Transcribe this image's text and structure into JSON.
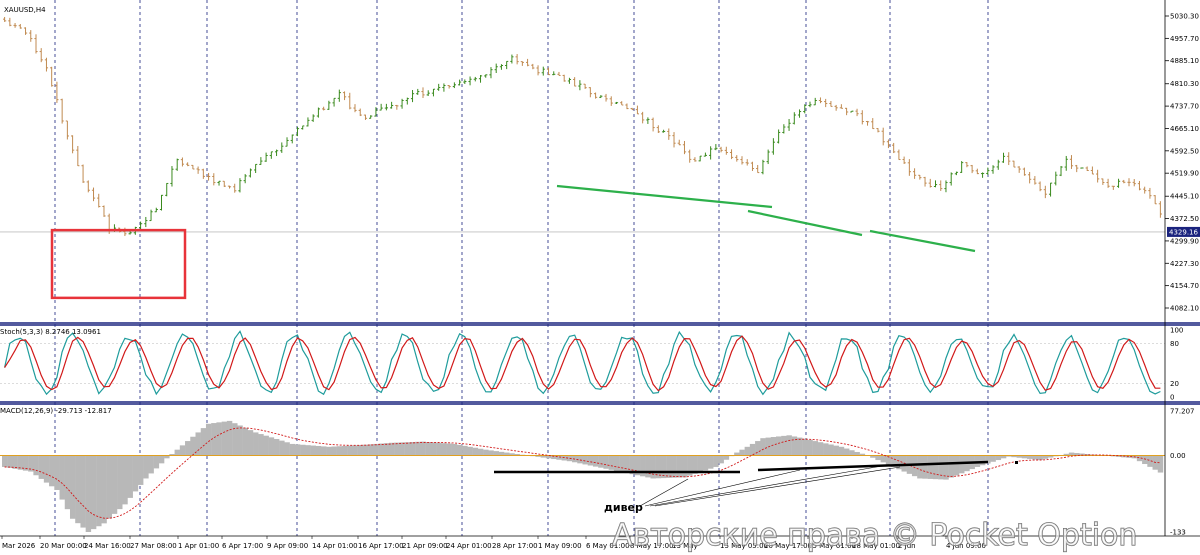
{
  "colors": {
    "up": "#3a8a1e",
    "down": "#c08a50",
    "stoch_main": "#1f9c9c",
    "stoch_signal": "#d11919",
    "macd_hist": "#b8b8b8",
    "macd_signal": "#d11919",
    "trend": "#2db04b",
    "box": "#e8333a",
    "zero_line": "#e0a020",
    "grid": "#1a237e",
    "cur_line": "#bfbfbf",
    "cur_bg": "#1a237e"
  },
  "header": {
    "symbol": "XAUUSD,H4",
    "stoch_label": "Stoch(5,3,3) 8.2746 13.0961",
    "macd_label": "MACD(12,26,9) -29.713 -12.817"
  },
  "annotation": {
    "text": "дивер"
  },
  "watermark": {
    "text": "Авторские права © Pocket Option"
  },
  "current_price_label": "4329.16",
  "chart_data": [
    {
      "type": "candlestick",
      "title": "XAUUSD,H4",
      "ylim": [
        4082.1,
        5030.3
      ],
      "y_ticks": [
        "5030.30",
        "4957.70",
        "4885.10",
        "4810.30",
        "4737.70",
        "4665.10",
        "4592.50",
        "4519.90",
        "4445.10",
        "4372.50",
        "4299.90",
        "4227.30",
        "4154.70",
        "4082.10"
      ],
      "x_ticks": [
        "Mar 2026",
        "20 Mar 00:00",
        "24 Mar 16:00",
        "27 Mar 08:00",
        "1 Apr 01:00",
        "6 Apr 17:00",
        "9 Apr 09:00",
        "14 Apr 01:00",
        "16 Apr 17:00",
        "21 Apr 09:00",
        "24 Apr 01:00",
        "28 Apr 17:00",
        "1 May 09:00",
        "6 May 01:00",
        "8 May 17:00",
        "13 May",
        "15 May 05:00",
        "20 May 17:00",
        "25 May 01:00",
        "28 May 01:00",
        "2 Jun",
        "4 Jun 09:00"
      ],
      "current_price": 4329.16,
      "close_path": [
        [
          0,
          5010
        ],
        [
          4,
          4980
        ],
        [
          8,
          4860
        ],
        [
          12,
          4640
        ],
        [
          15,
          4490
        ],
        [
          18,
          4420
        ],
        [
          20,
          4340
        ],
        [
          24,
          4320
        ],
        [
          29,
          4410
        ],
        [
          33,
          4570
        ],
        [
          38,
          4510
        ],
        [
          44,
          4470
        ],
        [
          49,
          4560
        ],
        [
          55,
          4640
        ],
        [
          60,
          4720
        ],
        [
          64,
          4780
        ],
        [
          68,
          4700
        ],
        [
          73,
          4730
        ],
        [
          78,
          4770
        ],
        [
          83,
          4800
        ],
        [
          88,
          4820
        ],
        [
          93,
          4850
        ],
        [
          97,
          4900
        ],
        [
          101,
          4860
        ],
        [
          105,
          4840
        ],
        [
          109,
          4810
        ],
        [
          113,
          4770
        ],
        [
          118,
          4740
        ],
        [
          123,
          4690
        ],
        [
          128,
          4620
        ],
        [
          132,
          4555
        ],
        [
          136,
          4605
        ],
        [
          140,
          4570
        ],
        [
          144,
          4520
        ],
        [
          148,
          4650
        ],
        [
          152,
          4720
        ],
        [
          155,
          4760
        ],
        [
          159,
          4740
        ],
        [
          163,
          4710
        ],
        [
          167,
          4650
        ],
        [
          171,
          4560
        ],
        [
          175,
          4500
        ],
        [
          179,
          4470
        ],
        [
          183,
          4550
        ],
        [
          187,
          4520
        ],
        [
          191,
          4570
        ],
        [
          195,
          4510
        ],
        [
          199,
          4460
        ],
        [
          203,
          4560
        ],
        [
          207,
          4520
        ],
        [
          211,
          4480
        ],
        [
          215,
          4490
        ],
        [
          219,
          4450
        ],
        [
          221,
          4380
        ]
      ],
      "seed": 20260320
    },
    {
      "type": "line",
      "title": "Stoch(5,3,3) 8.2746 13.0961",
      "ylim": [
        0,
        100
      ],
      "y_ticks": [
        "100",
        "80",
        "20",
        "0"
      ],
      "series": [
        {
          "name": "main",
          "values": []
        },
        {
          "name": "signal",
          "values": []
        }
      ],
      "periods": 42,
      "last_main": 8.2746,
      "last_signal": 13.0961
    },
    {
      "type": "bar",
      "title": "MACD(12,26,9) -29.713 -12.817",
      "ylim": [
        -133.0,
        77.207
      ],
      "y_ticks": [
        "77.207",
        "0.00",
        "-133"
      ],
      "macd_path": [
        [
          0,
          -20
        ],
        [
          5,
          -28
        ],
        [
          10,
          -60
        ],
        [
          13,
          -110
        ],
        [
          16,
          -133
        ],
        [
          19,
          -118
        ],
        [
          23,
          -85
        ],
        [
          27,
          -40
        ],
        [
          31,
          -5
        ],
        [
          35,
          25
        ],
        [
          39,
          55
        ],
        [
          43,
          60
        ],
        [
          48,
          40
        ],
        [
          55,
          20
        ],
        [
          62,
          15
        ],
        [
          68,
          18
        ],
        [
          74,
          22
        ],
        [
          80,
          24
        ],
        [
          86,
          20
        ],
        [
          92,
          10
        ],
        [
          100,
          0
        ],
        [
          108,
          -10
        ],
        [
          116,
          -25
        ],
        [
          124,
          -40
        ],
        [
          130,
          -38
        ],
        [
          136,
          -20
        ],
        [
          140,
          5
        ],
        [
          145,
          30
        ],
        [
          150,
          35
        ],
        [
          155,
          25
        ],
        [
          160,
          15
        ],
        [
          165,
          0
        ],
        [
          170,
          -20
        ],
        [
          175,
          -40
        ],
        [
          180,
          -42
        ],
        [
          186,
          -20
        ],
        [
          192,
          -2
        ],
        [
          198,
          -8
        ],
        [
          204,
          5
        ],
        [
          210,
          0
        ],
        [
          216,
          -5
        ],
        [
          221,
          -29.713
        ]
      ],
      "last_macd": -29.713,
      "last_signal": -12.817
    }
  ]
}
